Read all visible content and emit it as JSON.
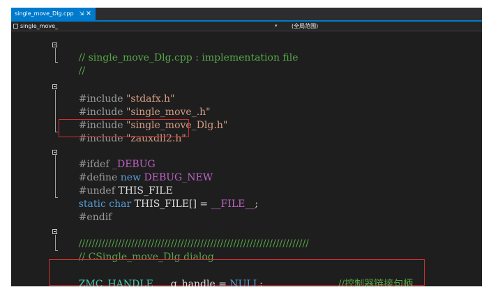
{
  "tab": {
    "filename": "single_move_Dlg.cpp",
    "pin_glyph": "⇲",
    "close_glyph": "✕"
  },
  "navbar": {
    "project": "single_move_",
    "dropdown_glyph": "▾",
    "scope": "(全局范围)"
  },
  "code": {
    "l1_comment": "// single_move_Dlg.cpp : implementation file",
    "l2_comment": "//",
    "l3_directive": "#include ",
    "l3_string": "\"stdafx.h\"",
    "l4_directive": "#include ",
    "l4_string": "\"single_move_.h\"",
    "l5_directive": "#include ",
    "l5_string": "\"single_move_Dlg.h\"",
    "l6_directive": "#include ",
    "l6_string": "\"zauxdll2.h\"",
    "l7_directive": "#ifdef ",
    "l7_macro": "_DEBUG",
    "l8_directive": "#define ",
    "l8_keyword": "new",
    "l8_macro": " DEBUG_NEW",
    "l9_directive": "#undef ",
    "l9_ident": "THIS_FILE",
    "l10_kw1": "static",
    "l10_kw2": " char",
    "l10_ident": " THIS_FILE[] = ",
    "l10_macro": "__FILE__",
    "l10_end": ";",
    "l11_directive": "#endif",
    "l12_comment": "//////////////////////////////////////////////////////////////////////",
    "l13_comment": "// CSingle_move_Dlg dialog",
    "l14_type": "ZMC_HANDLE",
    "l14_ident": "g_handle = ",
    "l14_null": "NULL",
    "l14_end": ";",
    "l14_comment": "//控制器链接句柄"
  }
}
